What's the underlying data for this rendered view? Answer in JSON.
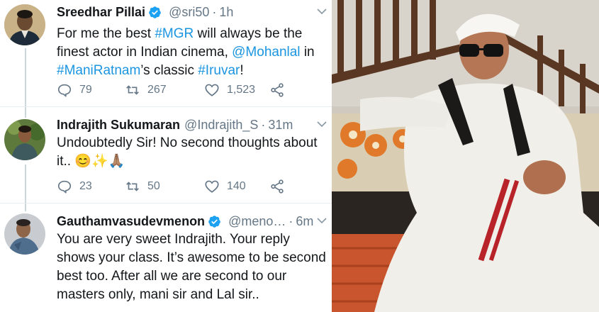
{
  "tweets": [
    {
      "name": "Sreedhar Pillai",
      "verified": true,
      "handle": "@sri50",
      "time": "1h",
      "text_parts": [
        {
          "t": "For me the best ",
          "link": false
        },
        {
          "t": "#MGR",
          "link": true
        },
        {
          "t": " will always be the finest actor in Indian cinema, ",
          "link": false
        },
        {
          "t": "@Mohanlal",
          "link": true
        },
        {
          "t": " in ",
          "link": false
        },
        {
          "t": "#ManiRatnam",
          "link": true
        },
        {
          "t": "’s classic ",
          "link": false
        },
        {
          "t": "#Iruvar",
          "link": true
        },
        {
          "t": "!",
          "link": false
        }
      ],
      "replies": "79",
      "retweets": "267",
      "likes": "1,523"
    },
    {
      "name": "Indrajith Sukumaran",
      "verified": false,
      "handle": "@Indrajith_S",
      "time": "31m",
      "text_parts": [
        {
          "t": "Undoubtedly Sir! No second thoughts about it.. 😊✨🙏🏽",
          "link": false
        }
      ],
      "replies": "23",
      "retweets": "50",
      "likes": "140"
    },
    {
      "name": "Gauthamvasudevmenon",
      "verified": true,
      "handle": "@meno…",
      "time": "6m",
      "text_parts": [
        {
          "t": "You are very sweet Indrajith. Your reply shows your class.  It’s awesome to be second best too. After all we are second to our masters only, mani sir and Lal sir..",
          "link": false
        }
      ]
    }
  ],
  "separator": "·",
  "icons": {
    "reply": "reply-icon",
    "retweet": "retweet-icon",
    "like": "heart-icon",
    "share": "share-icon",
    "verified": "verified-badge-icon",
    "menu": "chevron-down-icon"
  },
  "colors": {
    "link": "#1b95e0",
    "muted": "#657786",
    "verified": "#1da1f2",
    "thread_line": "#ccd6dd"
  }
}
